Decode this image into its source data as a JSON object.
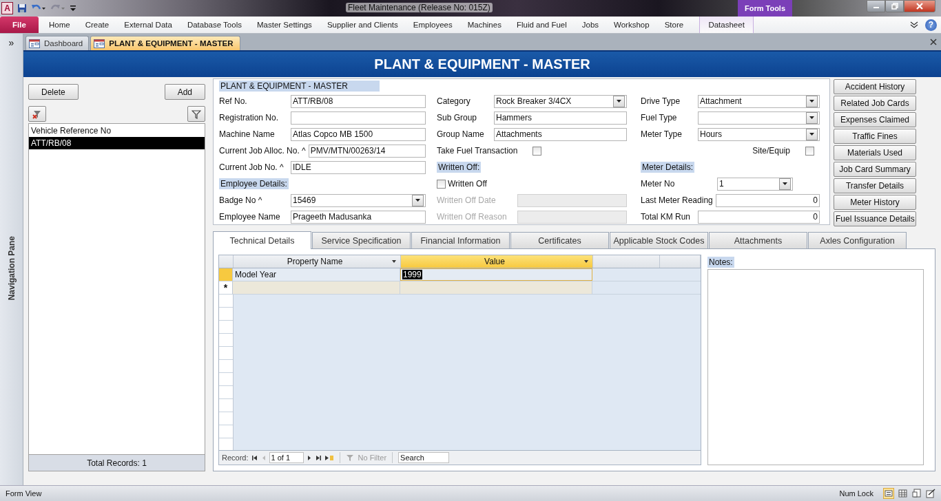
{
  "window": {
    "app_icon": "A",
    "title": "Fleet Maintenance (Release No: 015Z)",
    "contextual_group": "Form Tools"
  },
  "ribbon_tabs": [
    {
      "label": "File",
      "kind": "file",
      "selected": false
    },
    {
      "label": "Home",
      "kind": "tab",
      "selected": false
    },
    {
      "label": "Create",
      "kind": "tab",
      "selected": false
    },
    {
      "label": "External Data",
      "kind": "tab",
      "selected": false
    },
    {
      "label": "Database Tools",
      "kind": "tab",
      "selected": false
    },
    {
      "label": "Master Settings",
      "kind": "tab",
      "selected": false
    },
    {
      "label": "Supplier and Clients",
      "kind": "tab",
      "selected": false
    },
    {
      "label": "Employees",
      "kind": "tab",
      "selected": false
    },
    {
      "label": "Machines",
      "kind": "tab",
      "selected": false
    },
    {
      "label": "Fluid and Fuel",
      "kind": "tab",
      "selected": false
    },
    {
      "label": "Jobs",
      "kind": "tab",
      "selected": false
    },
    {
      "label": "Workshop",
      "kind": "tab",
      "selected": false
    },
    {
      "label": "Store",
      "kind": "tab",
      "selected": false
    },
    {
      "label": "Datasheet",
      "kind": "contextual",
      "selected": false
    }
  ],
  "help": "?",
  "navigation_pane": {
    "toggle": "»",
    "label": "Navigation Pane"
  },
  "document_tabs": [
    {
      "label": "Dashboard",
      "selected": false
    },
    {
      "label": "PLANT & EQUIPMENT - MASTER",
      "selected": true
    }
  ],
  "form_title": "PLANT & EQUIPMENT - MASTER",
  "record_list": {
    "buttons": [
      "Delete",
      "Add"
    ],
    "header": "Vehicle Reference No",
    "items": [
      {
        "text": "ATT/RB/08",
        "selected": true
      }
    ],
    "footer": "Total Records: 1"
  },
  "section_title": "PLANT & EQUIPMENT - MASTER",
  "columns": [
    [
      {
        "kind": "text",
        "label": "Ref No.",
        "value": "ATT/RB/08"
      },
      {
        "kind": "text",
        "label": "Registration No."
      },
      {
        "kind": "text",
        "label": "Machine Name",
        "value": "Atlas Copco MB 1500"
      },
      {
        "kind": "text",
        "label": "Current Job Alloc. No. ^",
        "value": "PMV/MTN/00263/14"
      },
      {
        "kind": "text",
        "label": "Current Job No. ^",
        "value": "IDLE"
      },
      {
        "kind": "section",
        "label": "Employee Details:"
      },
      {
        "kind": "combo",
        "label": "Badge No ^",
        "value": "15469"
      },
      {
        "kind": "text",
        "label": "Employee Name",
        "value": "Prageeth Madusanka"
      }
    ],
    [
      {
        "kind": "combo",
        "label": "Category",
        "value": "Rock Breaker 3/4CX"
      },
      {
        "kind": "text",
        "label": "Sub Group",
        "value": "Hammers"
      },
      {
        "kind": "text",
        "label": "Group Name",
        "value": "Attachments"
      },
      {
        "kind": "check",
        "label": "Take Fuel Transaction",
        "checked": false
      },
      {
        "kind": "section",
        "label": "Written Off:"
      },
      {
        "kind": "check-left",
        "label": "Written Off",
        "checked": false
      },
      {
        "kind": "disabled",
        "label": "Written Off Date"
      },
      {
        "kind": "disabled",
        "label": "Written Off Reason"
      }
    ],
    [
      {
        "kind": "combo",
        "label": "Drive Type",
        "value": "Attachment"
      },
      {
        "kind": "combo",
        "label": "Fuel Type"
      },
      {
        "kind": "combo",
        "label": "Meter Type",
        "value": "Hours"
      },
      {
        "kind": "check-right",
        "label": "Site/Equip",
        "checked": false
      },
      {
        "kind": "section",
        "label": "Meter Details:"
      },
      {
        "kind": "combo-short",
        "label": "Meter No",
        "value": "1"
      },
      {
        "kind": "number",
        "label": "Last Meter Reading",
        "value": "0"
      },
      {
        "kind": "number",
        "label": "Total KM Run",
        "value": "0"
      }
    ]
  ],
  "side_buttons": [
    "Accident History",
    "Related Job Cards",
    "Expenses Claimed",
    "Traffic Fines",
    "Materials Used",
    "Job Card Summary",
    "Transfer Details",
    "Meter History",
    "Fuel Issuance Details"
  ],
  "detail_tabs": [
    {
      "label": "Technical Details",
      "selected": true
    },
    {
      "label": "Service Specification",
      "selected": false
    },
    {
      "label": "Financial Information",
      "selected": false
    },
    {
      "label": "Certificates",
      "selected": false
    },
    {
      "label": "Applicable Stock Codes",
      "selected": false
    },
    {
      "label": "Attachments",
      "selected": false
    },
    {
      "label": "Axles Configuration",
      "selected": false
    }
  ],
  "datasheet": {
    "columns": [
      {
        "label": "Property Name",
        "selected": false
      },
      {
        "label": "Value",
        "selected": true
      }
    ],
    "rows": [
      {
        "cells": [
          "Model Year",
          "1999"
        ],
        "selected": true
      }
    ],
    "new_row_marker": "*",
    "navigator": {
      "label": "Record:",
      "position": "1 of 1",
      "filter": "No Filter",
      "search_placeholder": "Search"
    }
  },
  "notes": {
    "label": "Notes:"
  },
  "status_bar": {
    "left": "Form View",
    "right": "Num Lock"
  }
}
